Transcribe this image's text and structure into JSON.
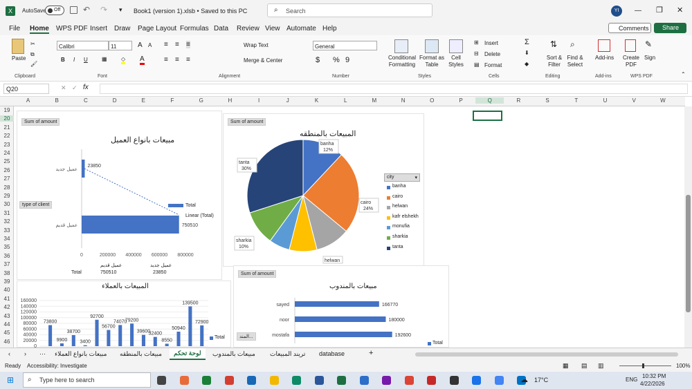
{
  "window": {
    "autosave": "AutoSave",
    "autosave_state": "Off",
    "title": "Book1 (version 1).xlsb • Saved to this PC",
    "search_placeholder": "Search",
    "user_initials": "YI"
  },
  "menu": [
    "File",
    "Home",
    "WPS PDF",
    "Insert",
    "Draw",
    "Page Layout",
    "Formulas",
    "Data",
    "Review",
    "View",
    "Automate",
    "Help"
  ],
  "buttons": {
    "comments": "Comments",
    "share": "Share"
  },
  "ribbon": {
    "clipboard": {
      "label": "Clipboard",
      "paste": "Paste"
    },
    "font": {
      "label": "Font",
      "name": "Calibri",
      "size": "11",
      "bold": "B",
      "italic": "I",
      "underline": "U"
    },
    "alignment": {
      "label": "Alignment",
      "wrap": "Wrap Text",
      "merge": "Merge & Center"
    },
    "number": {
      "label": "Number",
      "format": "General",
      "currency": "$",
      "percent": "%",
      "comma": "9"
    },
    "styles": {
      "label": "Styles",
      "conditional": "Conditional Formatting",
      "format_table": "Format as Table",
      "cell_styles": "Cell Styles"
    },
    "cells": {
      "label": "Cells",
      "insert": "Insert",
      "delete": "Delete",
      "format": "Format"
    },
    "editing": {
      "label": "Editing",
      "sort": "Sort & Filter",
      "find": "Find & Select"
    },
    "addins": {
      "label": "Add-ins",
      "addins": "Add-ins"
    },
    "wps": {
      "label": "WPS PDF",
      "create": "Create PDF",
      "sign": "Sign"
    }
  },
  "formula_bar": {
    "name_box": "Q20",
    "fx": "fx"
  },
  "columns": [
    "A",
    "B",
    "C",
    "D",
    "E",
    "F",
    "G",
    "H",
    "I",
    "J",
    "K",
    "L",
    "M",
    "N",
    "O",
    "P",
    "Q",
    "R",
    "S",
    "T",
    "U",
    "V",
    "W"
  ],
  "rows": [
    "19",
    "20",
    "21",
    "22",
    "23",
    "24",
    "25",
    "26",
    "27",
    "28",
    "29",
    "30",
    "31",
    "32",
    "33",
    "34",
    "35",
    "36",
    "37",
    "38",
    "39",
    "40",
    "41",
    "42",
    "43",
    "44",
    "45",
    "46"
  ],
  "chart1": {
    "pill": "Sum of amount",
    "title": "مبيعات بانواع العميل",
    "filter": "type of client",
    "legend_total": "Total",
    "legend_linear": "Linear (Total)",
    "chart_data": {
      "type": "bar",
      "categories": [
        "عميل جديد",
        "عميل قديم"
      ],
      "series": [
        {
          "name": "Total",
          "values": [
            23850,
            750510
          ]
        }
      ],
      "xticks": [
        "0",
        "200000",
        "400000",
        "600000",
        "800000"
      ],
      "xlim": [
        0,
        800000
      ]
    },
    "table": {
      "headers": [
        "عميل قديم",
        "عميل جديد"
      ],
      "row_label": "Total",
      "values": [
        "750510",
        "23850"
      ]
    }
  },
  "chart2": {
    "pill": "Sum of amount",
    "title": "المبيعات بالمنطقه",
    "legend_title": "city",
    "chart_data": {
      "type": "pie",
      "labels": [
        "banha",
        "cairo",
        "helwan",
        "kafr elshekh",
        "monufia",
        "sharkia",
        "tanta"
      ],
      "values": [
        12,
        24,
        10,
        8,
        6,
        10,
        30
      ],
      "colors": [
        "#4472c4",
        "#ed7d31",
        "#a5a5a5",
        "#ffc000",
        "#5b9bd5",
        "#70ad47",
        "#264478"
      ]
    },
    "data_labels": [
      {
        "name": "banha",
        "pct": "12%"
      },
      {
        "name": "cairo",
        "pct": "24%"
      },
      {
        "name": "sharkia",
        "pct": "10%"
      },
      {
        "name": "tanta",
        "pct": "30%"
      },
      {
        "name": "helwan",
        "pct": ""
      }
    ]
  },
  "chart3": {
    "title": "المبيعات بالعملاء",
    "legend": "Total",
    "chart_data": {
      "type": "bar",
      "values": [
        73800,
        9900,
        38700,
        3400,
        92700,
        56700,
        74070,
        79200,
        39600,
        32400,
        8550,
        50940,
        139500,
        72900
      ],
      "yticks": [
        "160000",
        "140000",
        "120000",
        "100000",
        "80000",
        "60000",
        "40000",
        "20000",
        "0"
      ],
      "ylim": [
        0,
        160000
      ]
    }
  },
  "chart4": {
    "pill": "Sum of amount",
    "title": "مبيعات بالمندوب",
    "legend": "Total",
    "filter": "المند...",
    "chart_data": {
      "type": "bar",
      "categories": [
        "sayed",
        "noor",
        "mostafa"
      ],
      "values": [
        166770,
        180000,
        192600
      ]
    }
  },
  "sheets": [
    "مبيعات بانواع العملاء",
    "مبيعات بالمنطقه",
    "لوحة تحكم",
    "مبيعات بالمندوب",
    "تريند المبيعات",
    "database"
  ],
  "active_sheet": "لوحة تحكم",
  "status": {
    "ready": "Ready",
    "accessibility": "Accessibility: Investigate",
    "zoom": "100%"
  },
  "taskbar": {
    "search": "Type here to search",
    "weather": "17°C",
    "lang": "ENG",
    "time": "10:32 PM",
    "date": "4/22/2026"
  }
}
